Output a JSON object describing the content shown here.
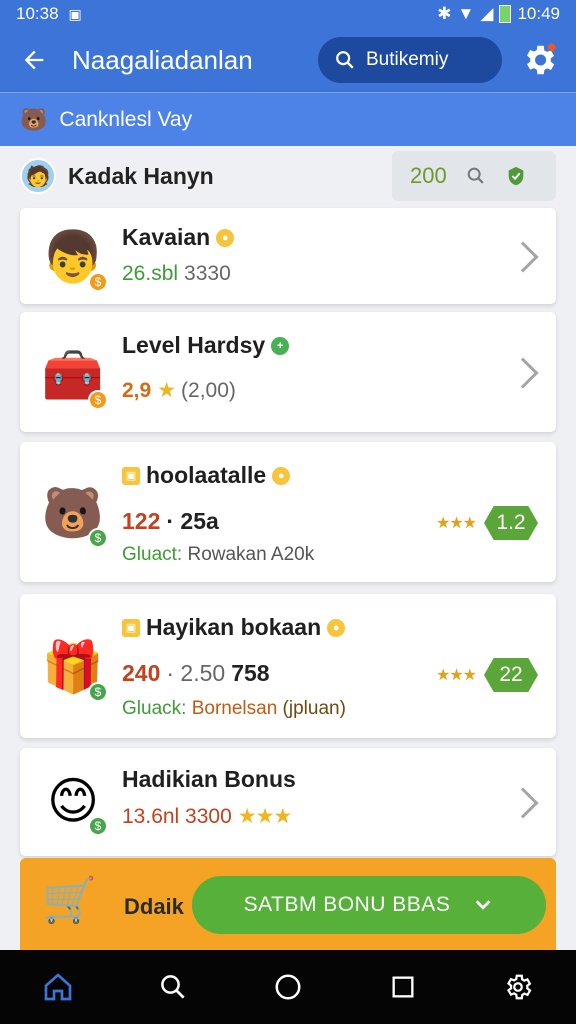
{
  "status": {
    "time": "10:38",
    "clock_right": "10:49"
  },
  "appbar": {
    "title": "Naagaliadanlan",
    "search_label": "Butikemiy"
  },
  "subbar": {
    "label": "Canknlesl Vay"
  },
  "user": {
    "name": "Kadak Hanyn",
    "points": "200"
  },
  "cards": [
    {
      "title": "Kavaian",
      "subtitle_green": "26.sbl",
      "subtitle_gray": "3330"
    },
    {
      "title": "Level Hardsy",
      "rating": "2,9",
      "count": "(2,00)"
    },
    {
      "title": "hoolaatalle",
      "value_a": "122",
      "value_b": "· 25a",
      "label": "Gluact:",
      "detail": "Rowakan A20k",
      "badge": "1.2"
    },
    {
      "title": "Hayikan bokaan",
      "value_a": "240",
      "value_b": "· 2.50",
      "value_c": "758",
      "label": "Gluack:",
      "detail": "Bornelsan",
      "detail_extra": "(jpluan)",
      "badge": "22"
    },
    {
      "title": "Hadikian Bonus",
      "subtitle": "13.6nl 3300"
    }
  ],
  "promo": {
    "label": "Ddaik",
    "cta": "SATBM BONU BBAS"
  },
  "colors": {
    "primary": "#3c74d8",
    "dark_pill": "#1d4a9e",
    "green": "#56b03a",
    "orange": "#f4a324"
  }
}
